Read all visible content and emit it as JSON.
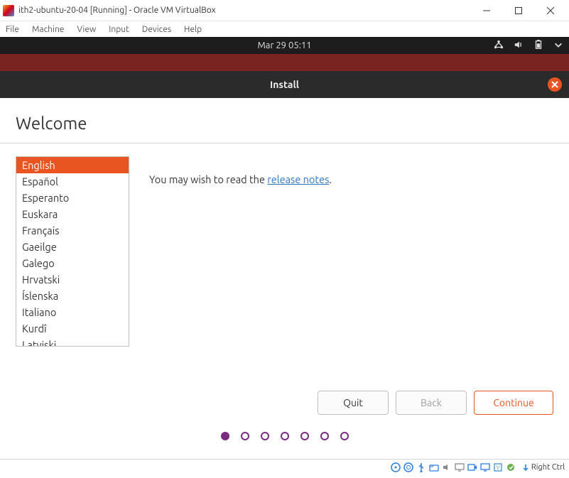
{
  "vbox": {
    "title": "ith2-ubuntu-20-04 [Running] - Oracle VM VirtualBox",
    "menu": {
      "file": "File",
      "machine": "Machine",
      "view": "View",
      "input": "Input",
      "devices": "Devices",
      "help": "Help"
    },
    "hostkey": "Right Ctrl"
  },
  "ubuntu_topbar": {
    "clock": "Mar 29  05:11"
  },
  "installer": {
    "titlebar": "Install",
    "heading": "Welcome",
    "languages": [
      "English",
      "Español",
      "Esperanto",
      "Euskara",
      "Français",
      "Gaeilge",
      "Galego",
      "Hrvatski",
      "Íslenska",
      "Italiano",
      "Kurdî",
      "Latviski"
    ],
    "selected_language_index": 0,
    "desc_prefix": "You may wish to read the ",
    "desc_link": "release notes",
    "desc_suffix": ".",
    "buttons": {
      "quit": "Quit",
      "back": "Back",
      "continue": "Continue"
    },
    "progress_total": 7,
    "progress_current": 0
  }
}
